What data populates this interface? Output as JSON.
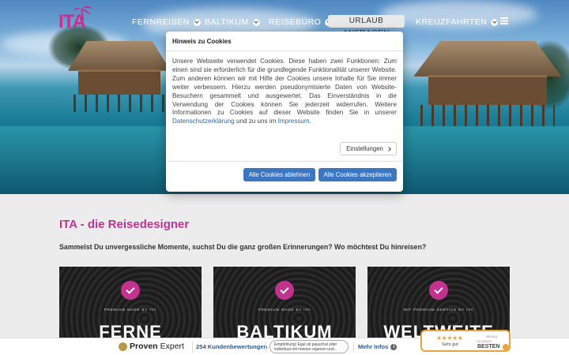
{
  "brand": {
    "logo_text": "ITA",
    "accent": "#c2338f"
  },
  "nav": {
    "items": [
      {
        "label": "FERNREISEN",
        "dropdown": true
      },
      {
        "label": "BALTIKUM",
        "dropdown": true
      },
      {
        "label": "REISEBÜRO",
        "dropdown": true
      }
    ],
    "cta": "URLAUB ANFRAGEN",
    "extra": {
      "label": "KREUZFAHRTEN",
      "dropdown": true
    },
    "menu_icon": "hamburger-icon"
  },
  "cookie_modal": {
    "title": "Hinweis zu Cookies",
    "text_before_privacy": "Unsere Webseite verwendet Cookies. Diese haben zwei Funktionen: Zum einen sind sie erforderlich für die grundlegende Funktionalität unserer Website. Zum anderen können wir mit Hilfe der Cookies unsere Inhalte für Sie immer weiter verbessern. Hierzu werden pseudonymisierte Daten von Website-Besuchern gesammelt und ausgewertet. Das Einverständnis in die Verwendung der Cookies können Sie jederzeit widerrufen. Weitere Informationen zu Cookies auf dieser Website finden Sie in unserer",
    "privacy_link": "Datenschutzerklärung",
    "text_between": "und zu uns im",
    "imprint_link": "Impressum",
    "text_end": ".",
    "settings_label": "Einstellungen",
    "decline_label": "Alle Cookies ablehnen",
    "accept_label": "Alle Cookies akzeptieren",
    "button_color": "#3a76c1"
  },
  "main": {
    "headline": "ITA - die Reisedesigner",
    "subline": "Sammelst Du unvergessliche Momente, suchst Du die ganz großen Erinnerungen? Wo möchtest Du hinreisen?",
    "cards": [
      {
        "tag": "PREMIUM MADE BY ITA",
        "title": "FERNE"
      },
      {
        "tag": "PREMIUM MADE BY ITA",
        "title": "BALTIKUM"
      },
      {
        "tag": "MIT PREMIUM SERVICE BY ITA",
        "title": "WELTWEITE"
      }
    ]
  },
  "proven_expert": {
    "logo_a": "Proven",
    "logo_b": "Expert",
    "reviews": "254 Kundenbewertungen",
    "recommendation": "Empfehlung! Egal ob pauschal oder individual mit meinen eigenen und...",
    "more": "Mehr Infos",
    "badge_stars": "★★★★★",
    "badge_rating": "Sehr gut",
    "badge_date": "08/2024",
    "badge_small": "ITA GROUP",
    "badge_best": "BESTEN"
  }
}
